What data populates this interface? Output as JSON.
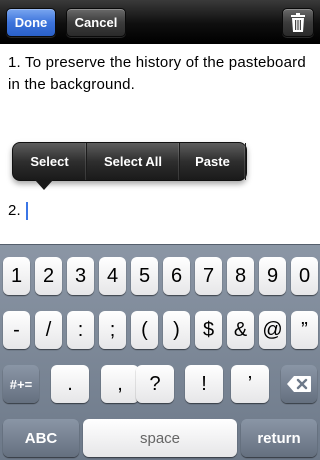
{
  "toolbar": {
    "done_label": "Done",
    "cancel_label": "Cancel",
    "trash_icon": "trash-icon"
  },
  "note": {
    "line1": "1. To preserve the history of the pasteboard in the background.",
    "line2": "2."
  },
  "edit_menu": {
    "items": [
      "Select",
      "Select All",
      "Paste"
    ]
  },
  "keyboard": {
    "row1": [
      "1",
      "2",
      "3",
      "4",
      "5",
      "6",
      "7",
      "8",
      "9",
      "0"
    ],
    "row2": [
      "-",
      "/",
      ":",
      ";",
      "(",
      ")",
      "$",
      "&",
      "@",
      "”"
    ],
    "row3_left": "#+=",
    "row3": [
      ".",
      ",",
      "?",
      "!",
      "’"
    ],
    "delete_icon": "backspace-icon",
    "row4": {
      "abc": "ABC",
      "space": "space",
      "return": "return"
    }
  },
  "colors": {
    "accent": "#3d74dc",
    "caret": "#3b76e6"
  }
}
